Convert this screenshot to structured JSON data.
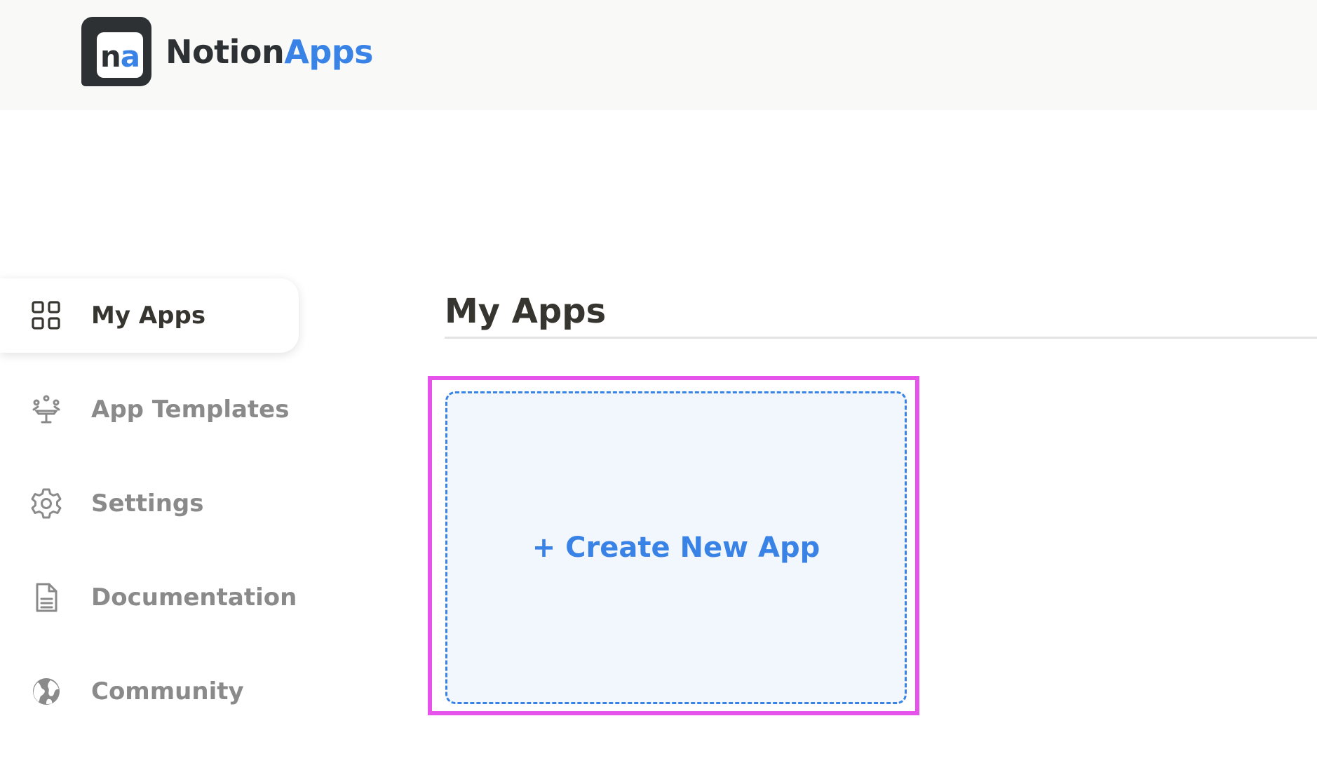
{
  "header": {
    "logo_mark": {
      "n": "n",
      "a": "a"
    },
    "brand_primary": "Notion",
    "brand_accent": "Apps",
    "background_color": "#f9f9f8"
  },
  "sidebar": {
    "items": [
      {
        "label": "My Apps",
        "icon": "grid-icon",
        "active": true
      },
      {
        "label": "App Templates",
        "icon": "templates-icon",
        "active": false
      },
      {
        "label": "Settings",
        "icon": "gear-icon",
        "active": false
      },
      {
        "label": "Documentation",
        "icon": "document-icon",
        "active": false
      },
      {
        "label": "Community",
        "icon": "globe-icon",
        "active": false
      }
    ]
  },
  "main": {
    "title": "My Apps",
    "create_card": {
      "label": "+ Create New App"
    }
  },
  "colors": {
    "accent": "#3a83e6",
    "text_dark": "#37352f",
    "text_muted": "#8a8a8a",
    "highlight": "#e653eb"
  }
}
